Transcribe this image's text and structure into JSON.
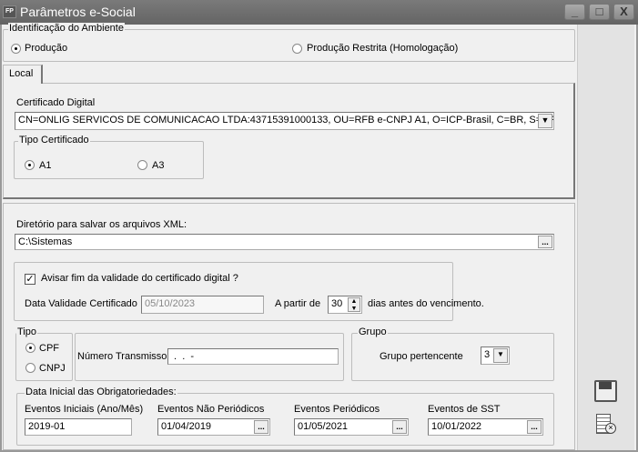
{
  "window": {
    "title": "Parâmetros e-Social",
    "app_icon": "FP",
    "min": "_",
    "max": "□",
    "close": "X"
  },
  "ambiente": {
    "legend": "Identificação do Ambiente",
    "options": [
      {
        "label": "Produção",
        "selected": true
      },
      {
        "label": "Produção Restrita (Homologação)",
        "selected": false
      }
    ]
  },
  "tabs": [
    {
      "label": "Local",
      "active": true
    }
  ],
  "certificado": {
    "label": "Certificado Digital",
    "value": "CN=ONLIG SERVICOS DE COMUNICACAO LTDA:43715391000133, OU=RFB e-CNPJ A1, O=ICP-Brasil, C=BR, S=SP, L",
    "tipo_legend": "Tipo Certificado",
    "tipos": [
      {
        "label": "A1",
        "selected": true
      },
      {
        "label": "A3",
        "selected": false
      }
    ]
  },
  "diretorio": {
    "label": "Diretório para salvar os arquivos XML:",
    "value": "C:\\Sistemas",
    "browse": "..."
  },
  "aviso": {
    "checkbox_label": "Avisar fim da validade do certificado digital ?",
    "checked": true,
    "data_label": "Data Validade Certificado",
    "data_value": "05/10/2023",
    "apartir_label": "A partir de",
    "dias_value": "30",
    "dias_suffix": "dias antes do vencimento."
  },
  "tipo": {
    "legend": "Tipo",
    "options": [
      {
        "label": "CPF",
        "selected": true
      },
      {
        "label": "CNPJ",
        "selected": false
      }
    ],
    "numero_label": "Número Transmissor",
    "numero_value": " .  .  -"
  },
  "grupo": {
    "legend": "Grupo",
    "label": "Grupo pertencente",
    "value": "3"
  },
  "obrigatoriedades": {
    "legend": "Data Inicial das Obrigatoriedades:",
    "fields": [
      {
        "label": "Eventos Iniciais (Ano/Mês)",
        "value": "2019-01"
      },
      {
        "label": "Eventos Não Periódicos",
        "value": "01/04/2019"
      },
      {
        "label": "Eventos Periódicos",
        "value": "01/05/2021"
      },
      {
        "label": "Eventos de SST",
        "value": "10/01/2022"
      }
    ]
  }
}
